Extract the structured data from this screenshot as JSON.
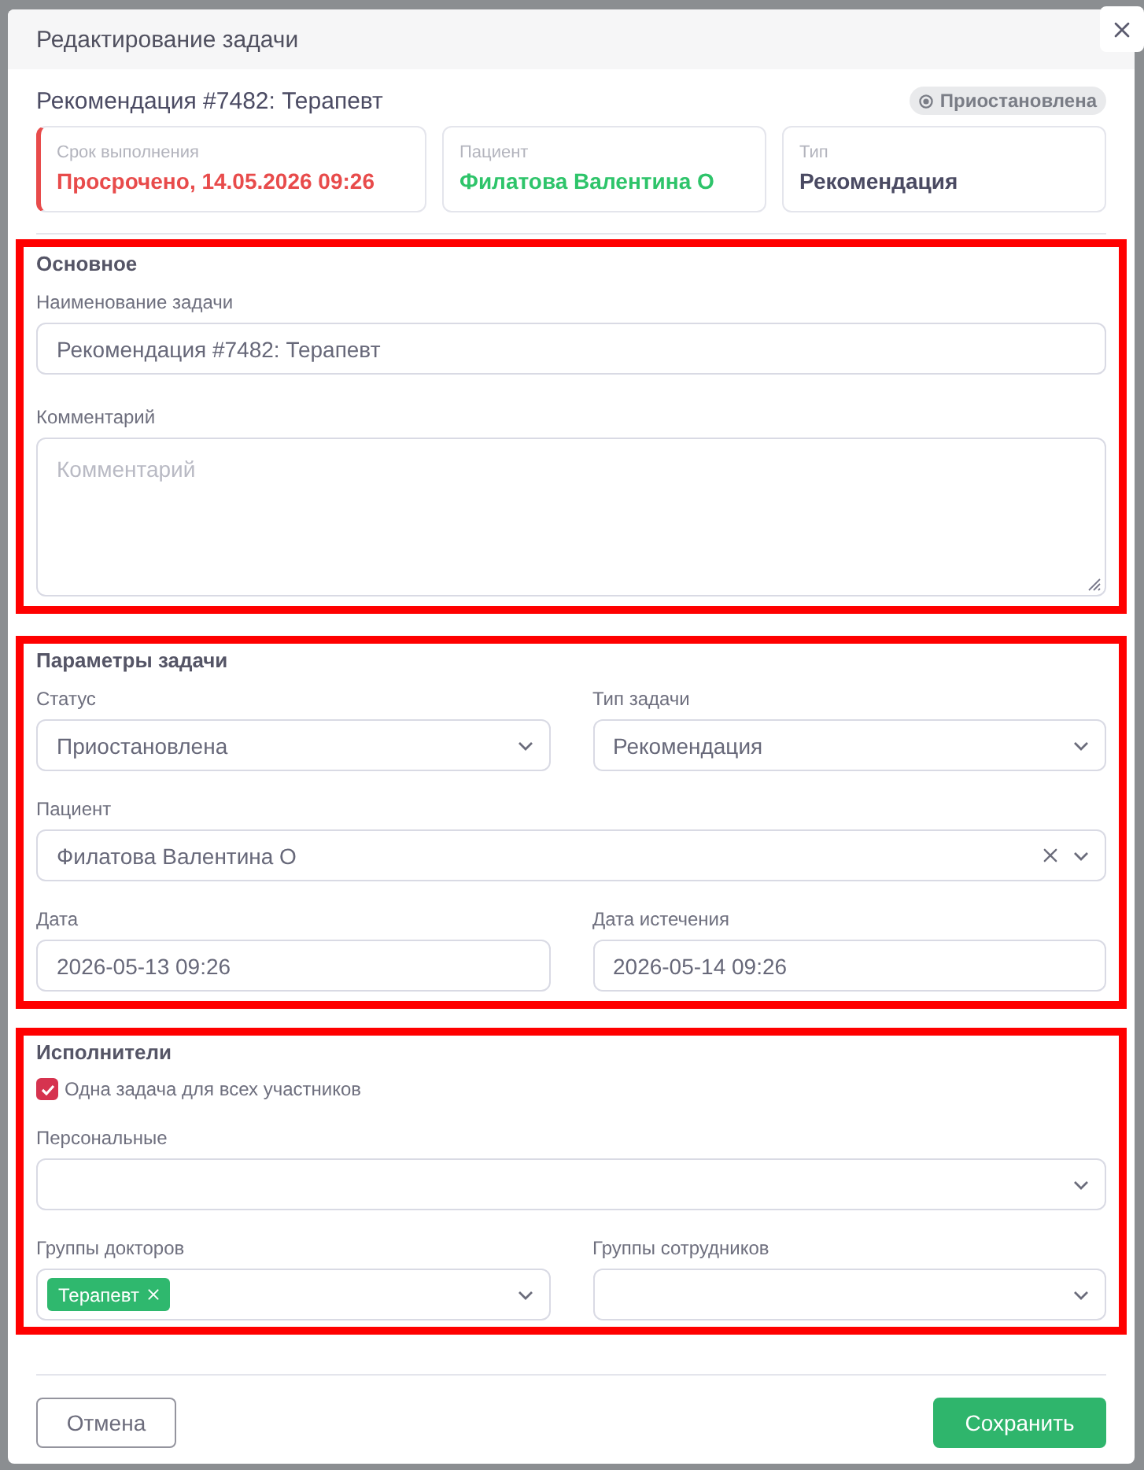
{
  "dialog": {
    "title": "Редактирование задачи"
  },
  "task": {
    "title": "Рекомендация #7482: Терапевт",
    "status": "Приостановлена"
  },
  "summary_cards": [
    {
      "kind": "overdue",
      "label": "Срок выполнения",
      "value": "Просрочено, 14.05.2026 09:26"
    },
    {
      "kind": "patient",
      "label": "Пациент",
      "value": "Филатова Валентина О"
    },
    {
      "kind": "plain",
      "label": "Тип",
      "value": "Рекомендация"
    }
  ],
  "sections": [
    {
      "title": "Основное",
      "highlighted": true,
      "rows": [
        [
          {
            "kind": "text",
            "label": "Наименование задачи",
            "value": "Рекомендация #7482: Терапевт"
          }
        ],
        [
          {
            "kind": "textarea",
            "label": "Комментарий",
            "placeholder": "Комментарий"
          }
        ]
      ]
    },
    {
      "title": "Параметры задачи",
      "highlighted": true,
      "rows": [
        [
          {
            "kind": "select",
            "label": "Статус",
            "value": "Приостановлена",
            "clearable": false
          },
          {
            "kind": "select",
            "label": "Тип задачи",
            "value": "Рекомендация",
            "clearable": false
          }
        ],
        [
          {
            "kind": "select",
            "label": "Пациент",
            "value": "Филатова Валентина О",
            "clearable": true
          }
        ],
        [
          {
            "kind": "text",
            "label": "Дата",
            "value": "2026-05-13 09:26"
          },
          {
            "kind": "text",
            "label": "Дата истечения",
            "value": "2026-05-14 09:26"
          }
        ]
      ]
    },
    {
      "title": "Исполнители",
      "highlighted": true,
      "rows": [
        [
          {
            "kind": "checkbox",
            "label": "Одна задача для всех участников",
            "checked": true
          }
        ],
        [
          {
            "kind": "select",
            "label": "Персональные",
            "clearable": false
          }
        ],
        [
          {
            "kind": "select",
            "label": "Группы докторов",
            "tags": [
              {
                "label": "Терапевт"
              }
            ],
            "clearable": false
          },
          {
            "kind": "select",
            "label": "Группы сотрудников",
            "clearable": false
          }
        ]
      ]
    }
  ],
  "footer": {
    "buttons": [
      {
        "kind": "secondary",
        "label": "Отмена"
      },
      {
        "kind": "primary",
        "label": "Сохранить"
      }
    ]
  }
}
